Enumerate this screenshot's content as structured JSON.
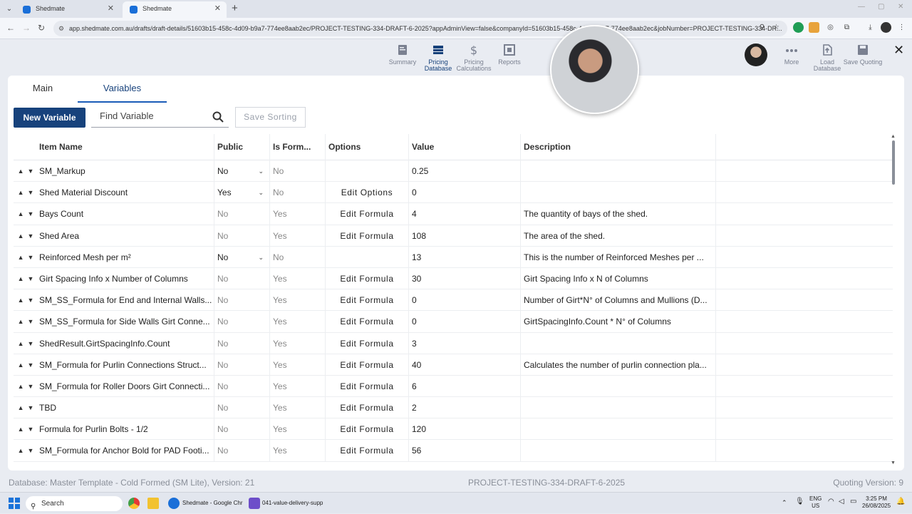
{
  "browser": {
    "tabs": [
      {
        "title": "Shedmate",
        "active": false
      },
      {
        "title": "Shedmate",
        "active": true
      }
    ],
    "url": "app.shedmate.com.au/drafts/draft-details/51603b15-458c-4d09-b9a7-774ee8aab2ec/PROJECT-TESTING-334-DRAFT-6-2025?appAdminView=false&companyId=51603b15-458c-4d09-b9a7-774ee8aab2ec&jobNumber=PROJECT-TESTING-334-DR..."
  },
  "header": {
    "nav": [
      {
        "label": "Summary",
        "icon": "summary-icon",
        "active": false
      },
      {
        "label": "Pricing Database",
        "icon": "database-icon",
        "active": true
      },
      {
        "label": "Pricing Calculations",
        "icon": "dollar-icon",
        "active": false
      },
      {
        "label": "Reports",
        "icon": "reports-icon",
        "active": false
      }
    ],
    "right": [
      {
        "label": "More",
        "icon": "more-icon"
      },
      {
        "label": "Load Database",
        "icon": "load-icon"
      },
      {
        "label": "Save Quoting",
        "icon": "save-icon"
      }
    ]
  },
  "tabs": {
    "main": "Main",
    "variables": "Variables"
  },
  "toolbar": {
    "new_variable": "New Variable",
    "search_placeholder": "Find Variable",
    "save_sorting": "Save Sorting"
  },
  "table": {
    "headers": {
      "item_name": "Item Name",
      "public": "Public",
      "is_formula": "Is Form...",
      "options": "Options",
      "value": "Value",
      "description": "Description"
    },
    "rows": [
      {
        "name": "SM_Markup",
        "public": "No",
        "public_select": true,
        "is_formula": "No",
        "options": "",
        "value": "0.25",
        "description": ""
      },
      {
        "name": "Shed Material Discount",
        "public": "Yes",
        "public_select": true,
        "is_formula": "No",
        "options": "Edit Options",
        "value": "0",
        "description": ""
      },
      {
        "name": "Bays Count",
        "public": "No",
        "public_select": false,
        "is_formula": "Yes",
        "options": "Edit Formula",
        "value": "4",
        "description": "The quantity of bays of the shed."
      },
      {
        "name": "Shed Area",
        "public": "No",
        "public_select": false,
        "is_formula": "Yes",
        "options": "Edit Formula",
        "value": "108",
        "description": "The area of the shed."
      },
      {
        "name": "Reinforced Mesh per m²",
        "public": "No",
        "public_select": true,
        "is_formula": "No",
        "options": "",
        "value": "13",
        "description": "This is the number of Reinforced Meshes per ..."
      },
      {
        "name": "Girt Spacing Info x Number of Columns",
        "public": "No",
        "public_select": false,
        "is_formula": "Yes",
        "options": "Edit Formula",
        "value": "30",
        "description": "Girt Spacing Info x N of Columns"
      },
      {
        "name": "SM_SS_Formula for End and Internal Walls...",
        "public": "No",
        "public_select": false,
        "is_formula": "Yes",
        "options": "Edit Formula",
        "value": "0",
        "description": "Number of Girt*N° of Columns and Mullions (D..."
      },
      {
        "name": "SM_SS_Formula for Side Walls Girt Conne...",
        "public": "No",
        "public_select": false,
        "is_formula": "Yes",
        "options": "Edit Formula",
        "value": "0",
        "description": "GirtSpacingInfo.Count * N° of Columns"
      },
      {
        "name": "ShedResult.GirtSpacingInfo.Count",
        "public": "No",
        "public_select": false,
        "is_formula": "Yes",
        "options": "Edit Formula",
        "value": "3",
        "description": ""
      },
      {
        "name": "SM_Formula for Purlin Connections Struct...",
        "public": "No",
        "public_select": false,
        "is_formula": "Yes",
        "options": "Edit Formula",
        "value": "40",
        "description": "Calculates the number of purlin connection pla..."
      },
      {
        "name": "SM_Formula for Roller Doors Girt Connecti...",
        "public": "No",
        "public_select": false,
        "is_formula": "Yes",
        "options": "Edit Formula",
        "value": "6",
        "description": ""
      },
      {
        "name": "TBD",
        "public": "No",
        "public_select": false,
        "is_formula": "Yes",
        "options": "Edit Formula",
        "value": "2",
        "description": ""
      },
      {
        "name": "Formula for Purlin Bolts - 1/2",
        "public": "No",
        "public_select": false,
        "is_formula": "Yes",
        "options": "Edit Formula",
        "value": "120",
        "description": ""
      },
      {
        "name": "SM_Formula for Anchor Bold for PAD Footi...",
        "public": "No",
        "public_select": false,
        "is_formula": "Yes",
        "options": "Edit Formula",
        "value": "56",
        "description": ""
      }
    ]
  },
  "status": {
    "database": "Database: Master Template - Cold Formed (SM Lite), Version: 21",
    "project": "PROJECT-TESTING-334-DRAFT-6-2025",
    "quoting_version": "Quoting Version: 9"
  },
  "taskbar": {
    "search": "Search",
    "apps": [
      "Shedmate - Google Chr",
      "041-value-delivery-supp"
    ],
    "lang_top": "ENG",
    "lang_bottom": "US",
    "time": "3:25 PM",
    "date": "26/08/2025"
  },
  "colors": {
    "primary": "#17427c",
    "accent": "#1a5cb8",
    "muted": "#888888"
  }
}
